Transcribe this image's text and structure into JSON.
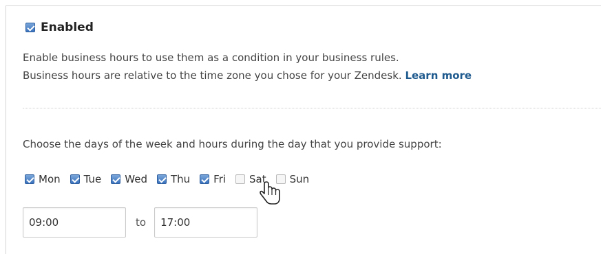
{
  "enabled": {
    "checked": true,
    "label": "Enabled"
  },
  "description": {
    "line1": "Enable business hours to use them as a condition in your business rules.",
    "line2": "Business hours are relative to the time zone you chose for your Zendesk.",
    "learn_more": "Learn more"
  },
  "days_prompt": "Choose the days of the week and hours during the day that you provide support:",
  "days": [
    {
      "label": "Mon",
      "checked": true
    },
    {
      "label": "Tue",
      "checked": true
    },
    {
      "label": "Wed",
      "checked": true
    },
    {
      "label": "Thu",
      "checked": true
    },
    {
      "label": "Fri",
      "checked": true
    },
    {
      "label": "Sat",
      "checked": false
    },
    {
      "label": "Sun",
      "checked": false
    }
  ],
  "hours": {
    "start": "09:00",
    "to_label": "to",
    "end": "17:00"
  },
  "colors": {
    "link": "#1f5a8e",
    "checkbox": "#3b73be"
  },
  "icons": {
    "cursor": "hand-pointer-icon"
  }
}
